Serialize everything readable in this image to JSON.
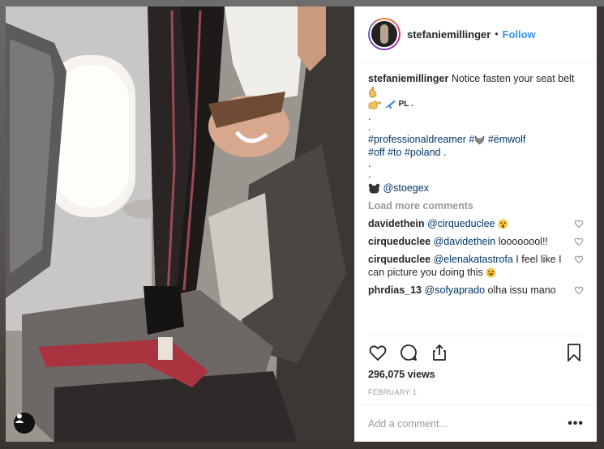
{
  "header": {
    "username": "stefaniemillinger",
    "separator": "•",
    "follow_label": "Follow"
  },
  "caption": {
    "username": "stefaniemillinger",
    "text": "Notice fasten your seat belt",
    "line2": "PL .",
    "dot": ".",
    "hashtags_1": [
      "#professionaldreamer",
      "#",
      "#ëmwolf"
    ],
    "hashtags_2": [
      "#off",
      "#to",
      "#poland"
    ],
    "hashtags_2_end": ".",
    "mention": "@stoegex"
  },
  "load_more": "Load more comments",
  "comments": [
    {
      "user": "davidethein",
      "mention": "@cirqueduclee",
      "text": ""
    },
    {
      "user": "cirqueduclee",
      "mention": "@davidethein",
      "text": "loooooool!!"
    },
    {
      "user": "cirqueduclee",
      "mention": "@elenakatastrofa",
      "text": "I feel like I can picture you doing this"
    },
    {
      "user": "phrdias_13",
      "mention": "@sofyaprado",
      "text": "olha issu mano"
    }
  ],
  "stats": {
    "views": "296,075 views",
    "date": "FEBRUARY 1"
  },
  "add_comment": {
    "placeholder": "Add a comment...",
    "more": "•••"
  },
  "icons": {
    "like": "heart-icon",
    "comment": "comment-icon",
    "share": "share-icon",
    "save": "bookmark-icon",
    "user_tag": "person-icon"
  },
  "colors": {
    "follow": "#3897f0",
    "hashtag": "#003569",
    "muted": "#999999",
    "text": "#262626"
  }
}
